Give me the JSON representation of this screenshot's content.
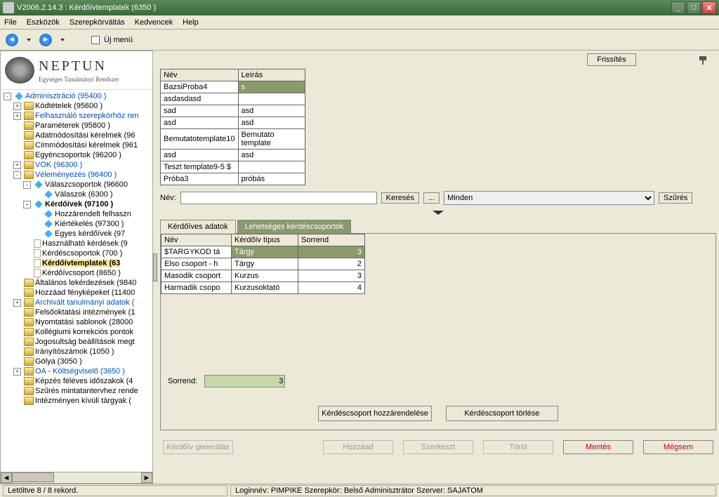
{
  "window": {
    "title": "V2006.2.14.3 : Kérdőívtemplatek (6350  )"
  },
  "menu": {
    "file": "File",
    "eszkozok": "Eszközök",
    "szerepkor": "Szerepkörváltás",
    "kedvencek": "Kedvencek",
    "help": "Help"
  },
  "newmenu_label": "Új menü",
  "brand": {
    "name": "NEPTUN",
    "sub": "Egységes Tanulmányi Rendszer"
  },
  "tree": [
    {
      "ind": 0,
      "exp": "-",
      "icon": "diamond",
      "cls": "link",
      "label": "Adminisztráció (95400  )"
    },
    {
      "ind": 1,
      "exp": "+",
      "icon": "folder",
      "cls": "normal",
      "label": "Kódtételek (95600  )"
    },
    {
      "ind": 1,
      "exp": "+",
      "icon": "folder",
      "cls": "link",
      "label": "Felhasználó szerepkörhöz ren"
    },
    {
      "ind": 1,
      "exp": " ",
      "icon": "folder",
      "cls": "normal",
      "label": "Paraméterek (95800  )"
    },
    {
      "ind": 1,
      "exp": " ",
      "icon": "folder",
      "cls": "normal",
      "label": "Adatmódosítási kérelmek (96"
    },
    {
      "ind": 1,
      "exp": " ",
      "icon": "folder",
      "cls": "normal",
      "label": "Címmódosítási kérelmek (961"
    },
    {
      "ind": 1,
      "exp": " ",
      "icon": "folder",
      "cls": "normal",
      "label": "Egyéncsoportok (96200  )"
    },
    {
      "ind": 1,
      "exp": "+",
      "icon": "folder",
      "cls": "link",
      "label": "VOK (96300  )"
    },
    {
      "ind": 1,
      "exp": "-",
      "icon": "folder",
      "cls": "link",
      "label": "Véleményezés (96400  )"
    },
    {
      "ind": 2,
      "exp": "-",
      "icon": "diamond",
      "cls": "normal",
      "label": "Válaszcsoportok (96600"
    },
    {
      "ind": 3,
      "exp": " ",
      "icon": "diamond",
      "cls": "normal",
      "label": "Válaszok (6300  )"
    },
    {
      "ind": 2,
      "exp": "-",
      "icon": "diamond",
      "cls": "bold",
      "label": "Kérdőívek (97100  )"
    },
    {
      "ind": 3,
      "exp": " ",
      "icon": "diamond",
      "cls": "normal",
      "label": "Hozzárendelt felhaszn"
    },
    {
      "ind": 3,
      "exp": " ",
      "icon": "diamond",
      "cls": "normal",
      "label": "Kiértékelés (97300  )"
    },
    {
      "ind": 3,
      "exp": " ",
      "icon": "diamond",
      "cls": "normal",
      "label": "Egyes kérdőívek (97"
    },
    {
      "ind": 2,
      "exp": " ",
      "icon": "page",
      "cls": "normal",
      "label": "Használható kérdések (9"
    },
    {
      "ind": 2,
      "exp": " ",
      "icon": "page",
      "cls": "normal",
      "label": "Kérdéscsoportok (700  )"
    },
    {
      "ind": 2,
      "exp": " ",
      "icon": "page",
      "cls": "normal sel bold",
      "label": "Kérdőívtemplatek (63"
    },
    {
      "ind": 2,
      "exp": " ",
      "icon": "page",
      "cls": "normal",
      "label": "Kérdőívcsoport (8650  )"
    },
    {
      "ind": 1,
      "exp": " ",
      "icon": "folder",
      "cls": "normal",
      "label": "Általános lekérdezések (9840"
    },
    {
      "ind": 1,
      "exp": " ",
      "icon": "folder",
      "cls": "normal",
      "label": "Hozzáad fényképeket (11400"
    },
    {
      "ind": 1,
      "exp": "+",
      "icon": "folder",
      "cls": "link",
      "label": "Archivált tanulmányi adatok ("
    },
    {
      "ind": 1,
      "exp": " ",
      "icon": "folder",
      "cls": "normal",
      "label": "Felsőoktatási intézmények (1"
    },
    {
      "ind": 1,
      "exp": " ",
      "icon": "folder",
      "cls": "normal",
      "label": "Nyomtatási sablonok (28000"
    },
    {
      "ind": 1,
      "exp": " ",
      "icon": "folder",
      "cls": "normal",
      "label": "Kollégiumi korrekciós pontok"
    },
    {
      "ind": 1,
      "exp": " ",
      "icon": "folder",
      "cls": "normal",
      "label": "Jogosultság beállítások megt"
    },
    {
      "ind": 1,
      "exp": " ",
      "icon": "folder",
      "cls": "normal",
      "label": "Irányítószámok (1050  )"
    },
    {
      "ind": 1,
      "exp": " ",
      "icon": "folder",
      "cls": "normal",
      "label": "Gólya (3050  )"
    },
    {
      "ind": 1,
      "exp": "+",
      "icon": "folder",
      "cls": "link",
      "label": "OA - Költségviselő (3650  )"
    },
    {
      "ind": 1,
      "exp": " ",
      "icon": "folder",
      "cls": "normal",
      "label": "Képzés féléves időszakok (4"
    },
    {
      "ind": 1,
      "exp": " ",
      "icon": "folder",
      "cls": "normal",
      "label": "Szűrés mintatantervhez rende"
    },
    {
      "ind": 1,
      "exp": " ",
      "icon": "folder",
      "cls": "normal",
      "label": "Intézményen kívüli tárgyak ("
    }
  ],
  "grid1": {
    "headers": {
      "nev": "Név",
      "leiras": "Leírás"
    },
    "rows": [
      {
        "nev": "BazsiProba4",
        "leiras": "s",
        "sel": true
      },
      {
        "nev": "asdasdasd",
        "leiras": ""
      },
      {
        "nev": "sad",
        "leiras": "asd"
      },
      {
        "nev": "asd",
        "leiras": "asd"
      },
      {
        "nev": "Bemutatotemplate10",
        "leiras": "Bemutato template"
      },
      {
        "nev": "asd",
        "leiras": "asd"
      },
      {
        "nev": "Teszt template9-5 $",
        "leiras": ""
      },
      {
        "nev": "Próba3",
        "leiras": "próbás"
      }
    ]
  },
  "search": {
    "label": "Név:",
    "kereses": "Keresés",
    "ellipsis": "...",
    "filter_option": "Minden",
    "szures": "Szűrés"
  },
  "tabs": {
    "t1": "Kérdőíves adatok",
    "t2": "Lehetséges kérdéscsoportok"
  },
  "grid2": {
    "headers": {
      "nev": "Név",
      "tipus": "Kérdőív típus",
      "sorrend": "Sorrend"
    },
    "rows": [
      {
        "nev": "$TARGYKOD tá",
        "tipus": "Tárgy",
        "sorrend": "3",
        "sel": true
      },
      {
        "nev": "Elso csoport - h",
        "tipus": "Tárgy",
        "sorrend": "2"
      },
      {
        "nev": "Masodik csoport",
        "tipus": "Kurzus",
        "sorrend": "3"
      },
      {
        "nev": "Harmadik csopo",
        "tipus": "Kurzusoktató",
        "sorrend": "4"
      }
    ]
  },
  "sorrend": {
    "label": "Sorrend:",
    "value": "3"
  },
  "assign": {
    "add": "Kérdéscsoport hozzárendelése",
    "del": "Kérdéscsoport törlése"
  },
  "actions": {
    "refresh": "Frissítés",
    "gen": "Kérdőív generálás",
    "hozzaad": "Hozzáad",
    "szerkeszt": "Szerkeszt",
    "torol": "Töröl",
    "mentes": "Mentés",
    "megsem": "Mégsem"
  },
  "status": {
    "records": "Letöltve 8 / 8 rekord.",
    "login": "Loginnév: PIMPIKE   Szerepkör: Belső Adminisztrátor   Szerver: SAJATOM"
  }
}
